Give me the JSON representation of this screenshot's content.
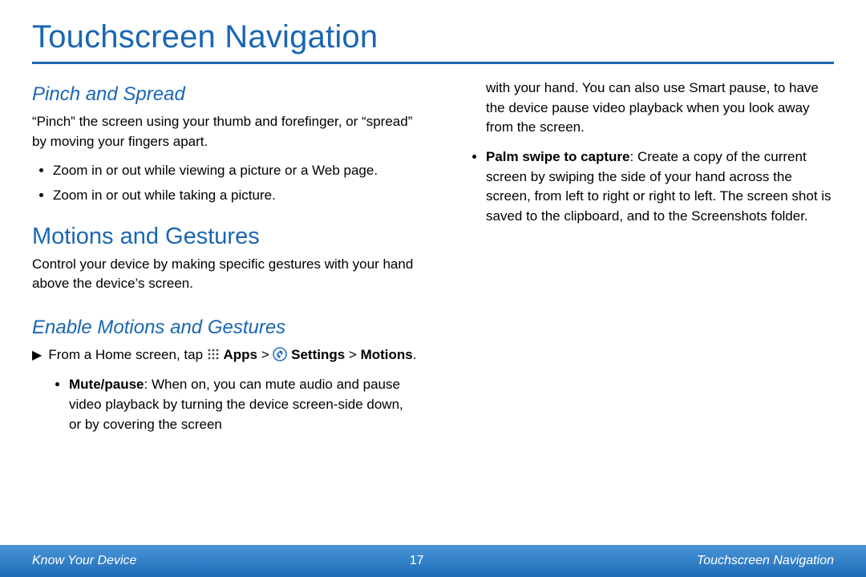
{
  "page": {
    "title": "Touchscreen Navigation"
  },
  "pinch": {
    "heading": "Pinch and Spread",
    "intro": "“Pinch” the screen using your thumb and forefinger, or “spread” by moving your fingers apart.",
    "items": [
      "Zoom in or out while viewing a picture or a Web page.",
      "Zoom in or out while taking a picture."
    ]
  },
  "motions": {
    "heading": "Motions and Gestures",
    "intro": "Control your device by making specific gestures with your hand above the device’s screen."
  },
  "enable": {
    "heading": "Enable Motions and Gestures",
    "step_prefix": "From a Home screen, tap ",
    "apps_label": "Apps",
    "gt1": " > ",
    "settings_label": "Settings",
    "gt2": " > ",
    "motions_label": "Motions",
    "period": ".",
    "mute": {
      "label": "Mute/pause",
      "text": ": When on, you can mute audio and pause video playback by turning the device screen-side down, or by covering the screen"
    }
  },
  "right": {
    "continuation": "with your hand. You can also use Smart pause, to have the device pause video playback when you look away from the screen.",
    "palm": {
      "label": "Palm swipe to capture",
      "text": ": Create a copy of the current screen by swiping the side of your hand across the screen, from left to right or right to left. The screen shot is saved to the clipboard, and to the Screenshots folder."
    }
  },
  "footer": {
    "left": "Know Your Device",
    "center": "17",
    "right": "Touchscreen Navigation"
  }
}
